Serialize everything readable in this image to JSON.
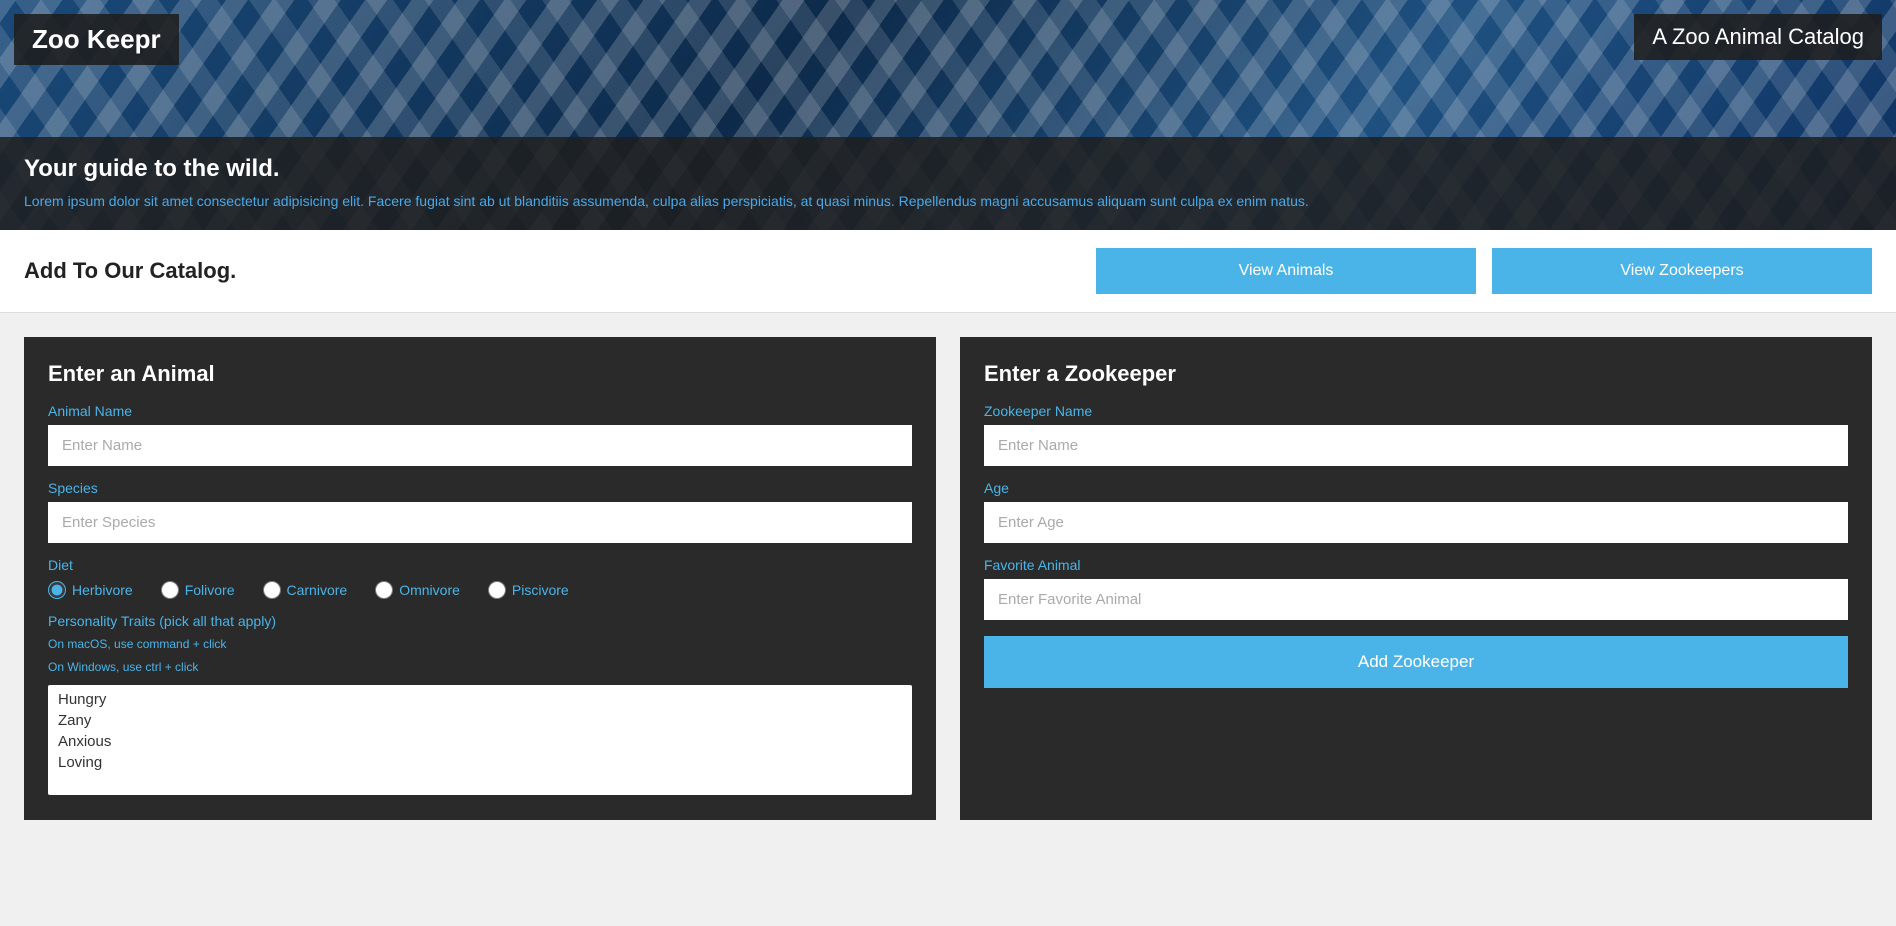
{
  "header": {
    "app_title": "Zoo Keepr",
    "app_subtitle": "A Zoo Animal Catalog"
  },
  "hero": {
    "tagline": "Your guide to the wild.",
    "description": "Lorem ipsum dolor sit amet consectetur adipisicing elit. Facere fugiat sint ab ut blanditiis assumenda, culpa alias perspiciatis, at quasi minus. Repellendus magni accusamus aliquam sunt culpa ex enim natus."
  },
  "navbar": {
    "title": "Add To Our Catalog.",
    "btn_animals": "View Animals",
    "btn_zookeepers": "View Zookeepers"
  },
  "animal_form": {
    "title": "Enter an Animal",
    "name_label": "Animal Name",
    "name_placeholder": "Enter Name",
    "species_label": "Species",
    "species_placeholder": "Enter Species",
    "diet_label": "Diet",
    "diet_options": [
      {
        "value": "herbivore",
        "label": "Herbivore",
        "checked": true
      },
      {
        "value": "folivore",
        "label": "Folivore",
        "checked": false
      },
      {
        "value": "carnivore",
        "label": "Carnivore",
        "checked": false
      },
      {
        "value": "omnivore",
        "label": "Omnivore",
        "checked": false
      },
      {
        "value": "piscivore",
        "label": "Piscivore",
        "checked": false
      }
    ],
    "traits_label": "Personality Traits (pick all that apply)",
    "traits_hint_mac": "On macOS, use command + click",
    "traits_hint_win": "On Windows, use ctrl + click",
    "traits_options": [
      "Hungry",
      "Zany",
      "Anxious",
      "Loving"
    ]
  },
  "zookeeper_form": {
    "title": "Enter a Zookeeper",
    "name_label": "Zookeeper Name",
    "name_placeholder": "Enter Name",
    "age_label": "Age",
    "age_placeholder": "Enter Age",
    "favorite_label": "Favorite Animal",
    "favorite_placeholder": "Enter Favorite Animal",
    "btn_add": "Add Zookeeper"
  }
}
